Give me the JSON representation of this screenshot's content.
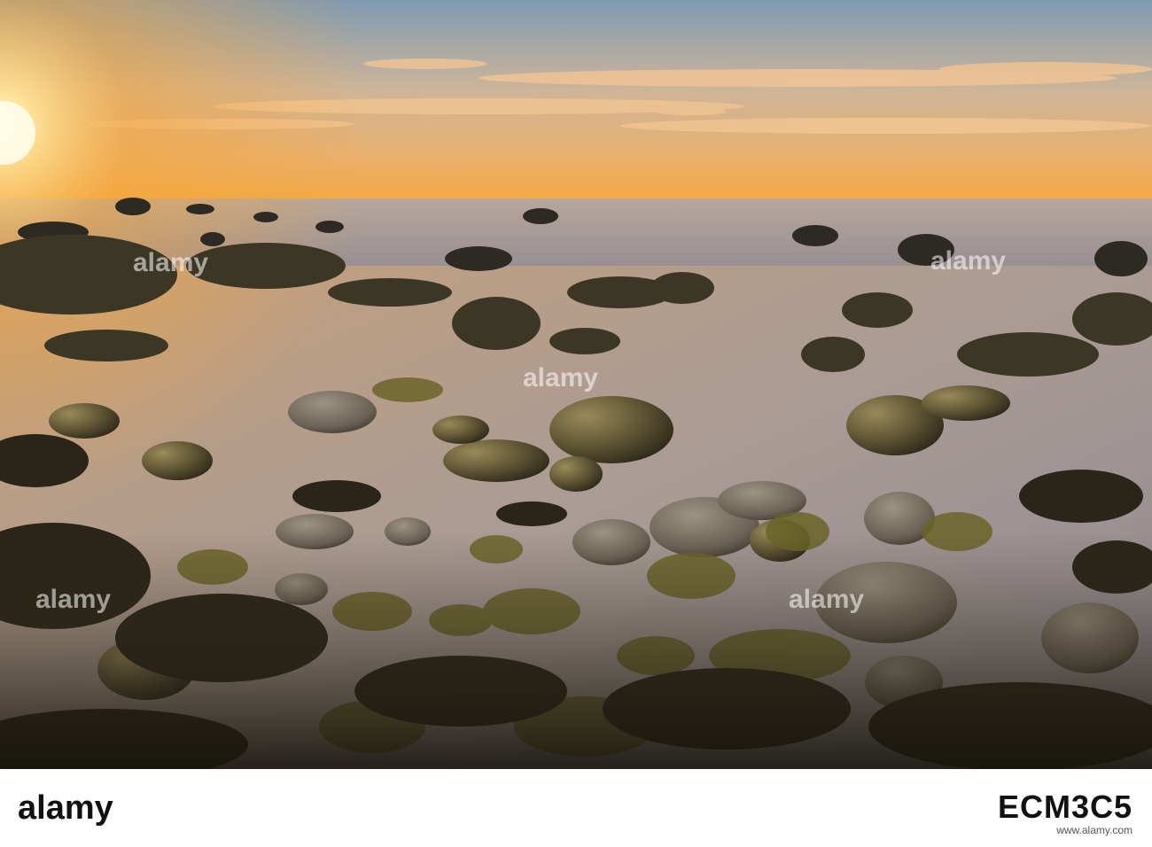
{
  "photo": {
    "subject": "Rocky tide pools at sunset",
    "colors": {
      "sky_top": "#7f9ab2",
      "sky_mid": "#e8b774",
      "sky_horizon": "#f6a63a",
      "sun": "#fff6c8",
      "sea": "#9c9aa2",
      "water_reflect": "#b59a86",
      "rock_dark": "#2e2a1d",
      "rock_mid": "#4f4830",
      "rock_lit": "#8a7a48",
      "weed": "#6d6a2a",
      "foreground": "#1d1a12"
    }
  },
  "watermark": {
    "logo_word": "alamy",
    "image_id": "ECM3C5",
    "footer": "www.alamy.com"
  }
}
